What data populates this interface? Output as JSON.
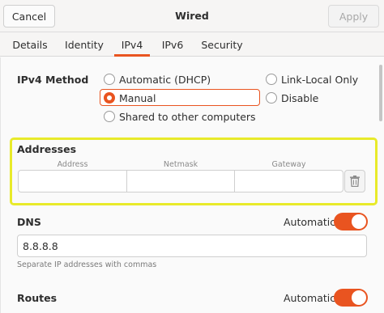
{
  "header": {
    "title": "Wired",
    "cancel_label": "Cancel",
    "apply_label": "Apply"
  },
  "tabs": [
    {
      "label": "Details"
    },
    {
      "label": "Identity"
    },
    {
      "label": "IPv4",
      "selected": true
    },
    {
      "label": "IPv6"
    },
    {
      "label": "Security"
    }
  ],
  "ipv4_method": {
    "label": "IPv4 Method",
    "options": [
      {
        "label": "Automatic (DHCP)",
        "checked": false
      },
      {
        "label": "Link-Local Only",
        "checked": false
      },
      {
        "label": "Manual",
        "checked": true
      },
      {
        "label": "Disable",
        "checked": false
      },
      {
        "label": "Shared to other computers",
        "checked": false
      }
    ]
  },
  "addresses": {
    "label": "Addresses",
    "columns": [
      "Address",
      "Netmask",
      "Gateway"
    ],
    "row": {
      "address": "",
      "netmask": "",
      "gateway": ""
    }
  },
  "dns": {
    "label": "DNS",
    "automatic_label": "Automatic",
    "automatic_on": true,
    "value": "8.8.8.8",
    "hint": "Separate IP addresses with commas"
  },
  "routes": {
    "label": "Routes",
    "automatic_label": "Automatic",
    "automatic_on": true
  },
  "colors": {
    "accent": "#e95420",
    "highlight": "#e8ea2a"
  },
  "icons": {
    "delete": "trash-icon"
  }
}
